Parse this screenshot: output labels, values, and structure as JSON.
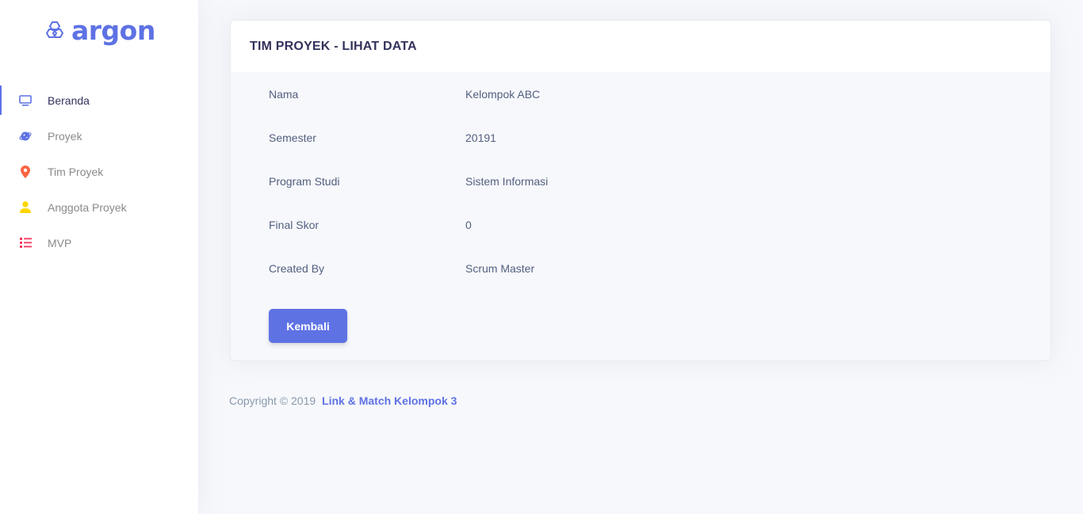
{
  "brand": {
    "name": "argon"
  },
  "sidebar": {
    "items": [
      {
        "label": "Beranda",
        "active": true,
        "icon": "monitor-icon",
        "color": "#5e72e4"
      },
      {
        "label": "Proyek",
        "active": false,
        "icon": "planet-icon",
        "color": "#5e72e4"
      },
      {
        "label": "Tim Proyek",
        "active": false,
        "icon": "pin-icon",
        "color": "#fb6340"
      },
      {
        "label": "Anggota Proyek",
        "active": false,
        "icon": "user-icon",
        "color": "#ffd600"
      },
      {
        "label": "MVP",
        "active": false,
        "icon": "list-icon",
        "color": "#f5365c"
      }
    ]
  },
  "card": {
    "title": "TIM PROYEK - LIHAT DATA",
    "rows": [
      {
        "label": "Nama",
        "value": "Kelompok ABC"
      },
      {
        "label": "Semester",
        "value": "20191"
      },
      {
        "label": "Program Studi",
        "value": "Sistem Informasi"
      },
      {
        "label": "Final Skor",
        "value": "0"
      },
      {
        "label": "Created By",
        "value": "Scrum Master"
      }
    ],
    "back_button": "Kembali"
  },
  "footer": {
    "copyright": "Copyright © 2019",
    "link": "Link & Match Kelompok 3"
  },
  "colors": {
    "primary": "#5e72e4",
    "heading": "#32325d",
    "text": "#525f7f",
    "muted": "#8898aa",
    "background": "#f7f8fc"
  }
}
